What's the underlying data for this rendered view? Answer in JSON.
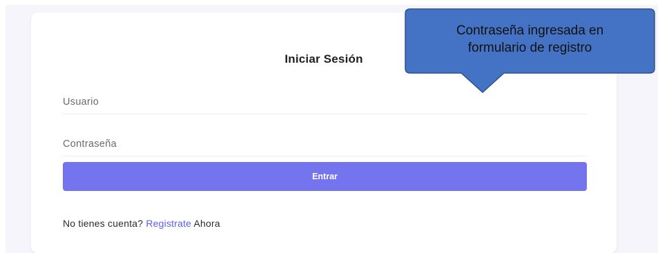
{
  "login": {
    "title": "Iniciar Sesión",
    "username_placeholder": "Usuario",
    "password_placeholder": "Contraseña",
    "submit_label": "Entrar",
    "signup_prefix": "No tienes cuenta? ",
    "signup_link": "Registrate",
    "signup_suffix": " Ahora"
  },
  "callout": {
    "text": "Contraseña ingresada en\nformulario de registro",
    "fill_color": "#4472c4",
    "border_color": "#2f528f"
  },
  "colors": {
    "accent": "#7474ef",
    "link": "#5b5bef",
    "page_background": "#f5f5fb"
  }
}
